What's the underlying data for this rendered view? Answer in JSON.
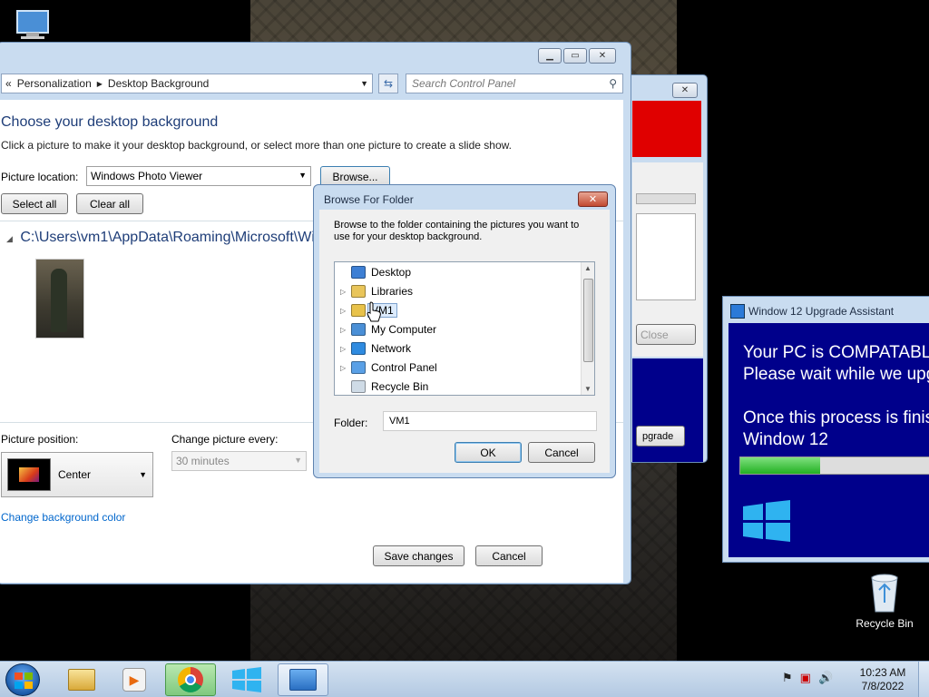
{
  "desktop": {
    "recycle_label": "Recycle Bin"
  },
  "main_window": {
    "breadcrumb": [
      "Personalization",
      "Desktop Background"
    ],
    "breadcrumb_prefix": "«",
    "search_placeholder": "Search Control Panel",
    "heading": "Choose your desktop background",
    "subheading": "Click a picture to make it your desktop background, or select more than one picture to create a slide show.",
    "picture_location_label": "Picture location:",
    "picture_location_value": "Windows Photo Viewer",
    "browse_label": "Browse...",
    "select_all_label": "Select all",
    "clear_all_label": "Clear all",
    "folder_path": "C:\\Users\\vm1\\AppData\\Roaming\\Microsoft\\Windo",
    "picture_position_label": "Picture position:",
    "picture_position_value": "Center",
    "change_every_label": "Change picture every:",
    "change_every_value": "30 minutes",
    "bg_color_link": "Change background color",
    "save_label": "Save changes",
    "cancel_label": "Cancel"
  },
  "browse_dialog": {
    "title": "Browse For Folder",
    "instructions": "Browse to the folder containing the pictures you want to use for your desktop background.",
    "tree": [
      {
        "label": "Desktop",
        "icon": "desktop-icon",
        "expandable": false
      },
      {
        "label": "Libraries",
        "icon": "libraries-icon",
        "expandable": true
      },
      {
        "label": "VM1",
        "icon": "user-folder-icon",
        "expandable": true,
        "selected": true
      },
      {
        "label": "My Computer",
        "icon": "computer-icon",
        "expandable": true
      },
      {
        "label": "Network",
        "icon": "network-icon",
        "expandable": true
      },
      {
        "label": "Control Panel",
        "icon": "control-panel-icon",
        "expandable": true
      },
      {
        "label": "Recycle Bin",
        "icon": "recycle-bin-icon",
        "expandable": false
      }
    ],
    "folder_label": "Folder:",
    "folder_value": "VM1",
    "ok_label": "OK",
    "cancel_label": "Cancel"
  },
  "back_window": {
    "close_label": "Close",
    "upgrade_label": "pgrade"
  },
  "upgrade_window": {
    "title": "Window 12 Upgrade Assistant",
    "line1": "Your PC is COMPATABL",
    "line2": "Please wait while we upg",
    "line3": "Once this process is finis",
    "line4": "Window 12",
    "progress": 0.4
  },
  "taskbar": {
    "time": "10:23 AM",
    "date": "7/8/2022"
  },
  "colors": {
    "accent_text": "#1e3d78",
    "link": "#0066cc",
    "upgrade_bg": "#00008b",
    "alert_red": "#e00000"
  }
}
